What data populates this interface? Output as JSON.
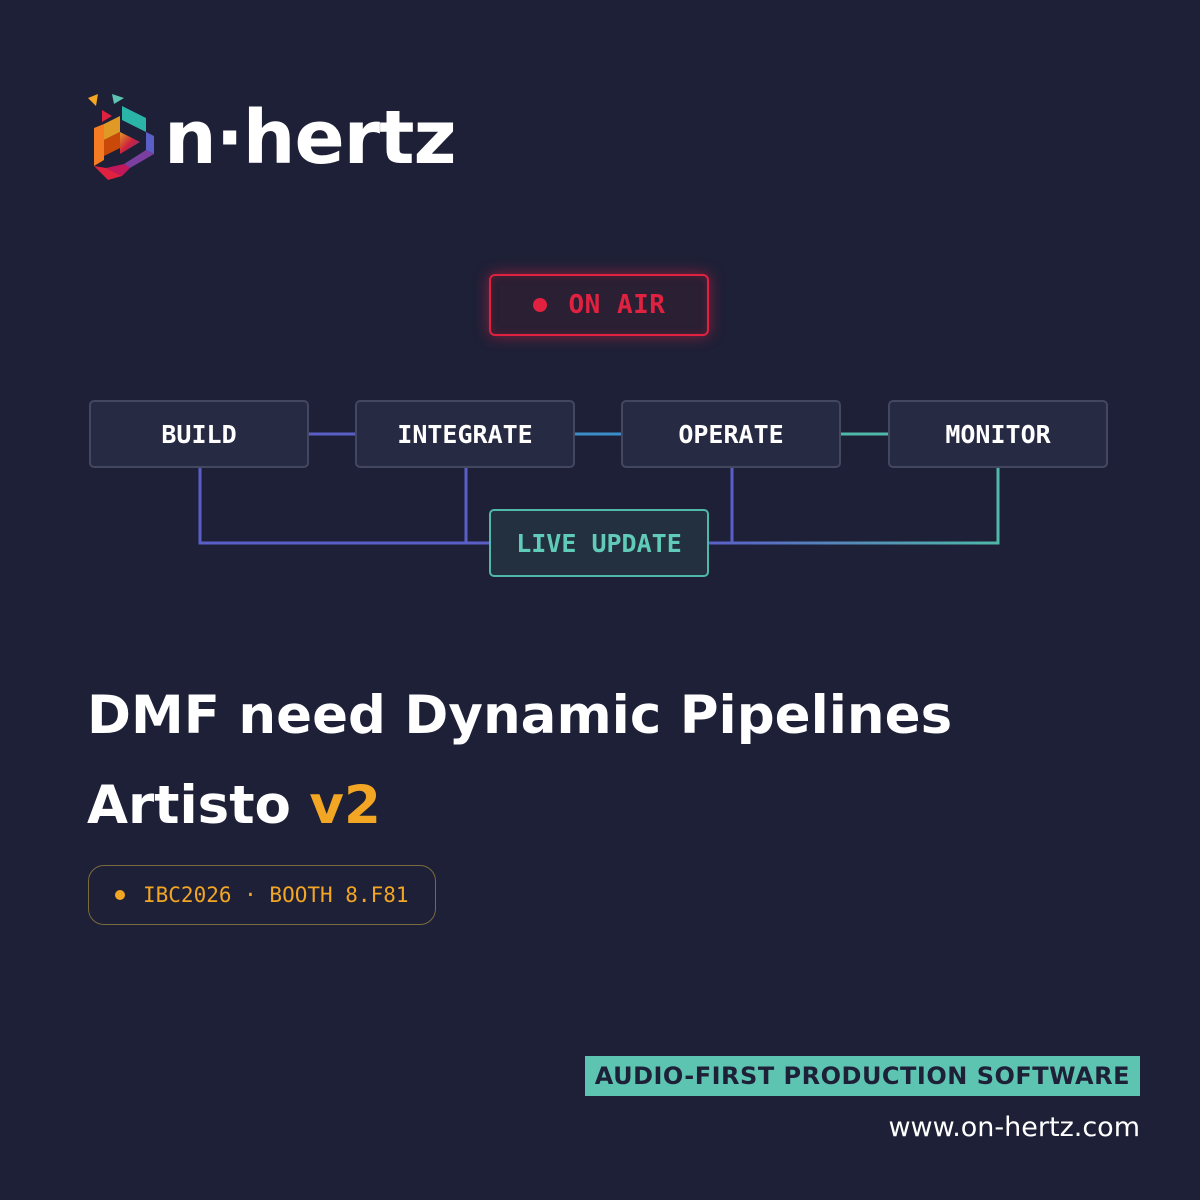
{
  "brand": {
    "name": "n·hertz",
    "full_name": "on-hertz"
  },
  "status": {
    "label": "ON AIR",
    "color": "#e0213f"
  },
  "pipeline": {
    "stages": [
      "BUILD",
      "INTEGRATE",
      "OPERATE",
      "MONITOR"
    ],
    "hub": "LIVE UPDATE"
  },
  "headline": "DMF need Dynamic Pipelines",
  "product": {
    "name": "Artisto",
    "version": "v2"
  },
  "event": {
    "label": "IBC2026 · BOOTH 8.F81"
  },
  "footer": {
    "tagline": "AUDIO-FIRST PRODUCTION SOFTWARE",
    "website": "www.on-hertz.com"
  },
  "colors": {
    "background": "#1e2037",
    "accent_orange": "#f2a623",
    "accent_teal": "#5ec4b2",
    "alert_red": "#e0213f"
  }
}
